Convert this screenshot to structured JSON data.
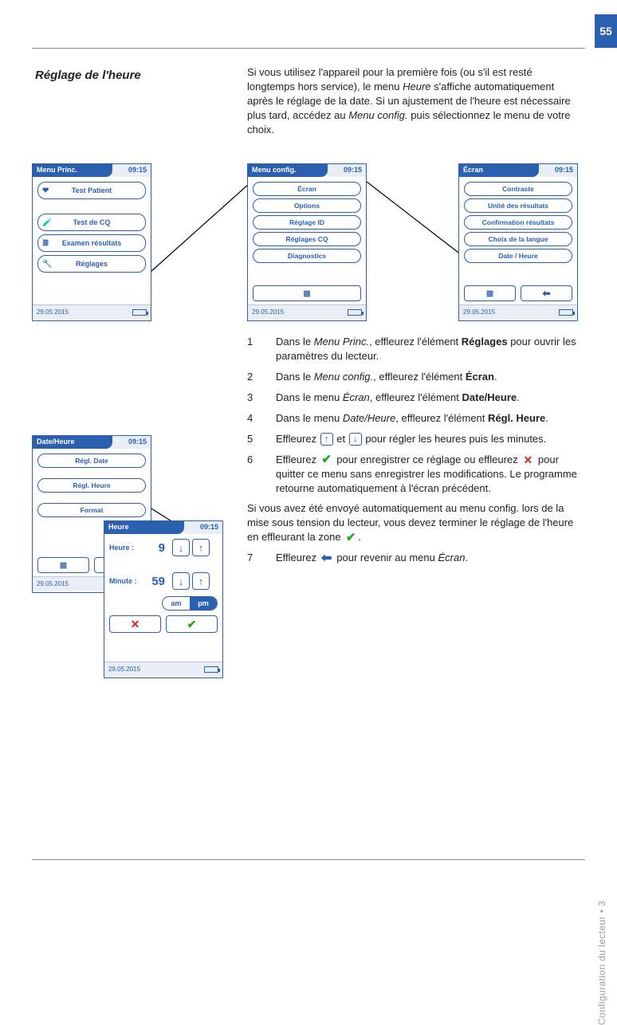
{
  "page_number": "55",
  "heading": "Réglage de l'heure",
  "intro_html": "Si vous utilisez l'appareil pour la première fois (ou s'il est resté longtemps hors service), le menu <span class='ital'>Heure</span> s'affiche automatiquement après le réglage de la date. Si un ajustement de l'heure est nécessaire plus tard, accédez au <span class='ital'>Menu config.</span> puis sélectionnez le menu de votre choix.",
  "side_label": "Configuration du lecteur • 3",
  "device_a": {
    "title": "Menu Princ.",
    "time": "09:15",
    "date": "29.05.2015",
    "items": [
      "Test Patient",
      "Test de CQ",
      "Examen résultats",
      "Réglages"
    ]
  },
  "device_b": {
    "title": "Menu config.",
    "time": "09:15",
    "date": "29.05.2015",
    "items": [
      "Écran",
      "Options",
      "Réglage ID",
      "Réglages CQ",
      "Diagnostics"
    ]
  },
  "device_c": {
    "title": "Écran",
    "time": "09:15",
    "date": "29.05.2015",
    "items": [
      "Contraste",
      "Unité des résultats",
      "Confirmation résultats",
      "Choix de la langue",
      "Date / Heure"
    ]
  },
  "device_d": {
    "title": "Date/Heure",
    "time": "09:15",
    "date": "29.05.2015",
    "items": [
      "Régl. Date",
      "Régl. Heure",
      "Format"
    ]
  },
  "device_e": {
    "title": "Heure",
    "time": "09:15",
    "date": "29.05.2015",
    "hour_label": "Heure :",
    "hour_value": "9",
    "minute_label": "Minute :",
    "minute_value": "59",
    "am": "am",
    "pm": "pm"
  },
  "steps": [
    {
      "n": "1",
      "html": "Dans le <span class='ital'>Menu Princ.</span>, effleurez l'élément <b>Réglages</b> pour ouvrir les paramètres du lecteur."
    },
    {
      "n": "2",
      "html": "Dans le <span class='ital'>Menu config.</span>, effleurez l'élément <b>Écran</b>."
    },
    {
      "n": "3",
      "html": "Dans le menu <span class='ital'>Écran</span>, effleurez l'élément <b>Date/Heure</b>."
    },
    {
      "n": "4",
      "html": "Dans le menu <span class='ital'>Date/Heure</span>, effleurez l'élément <b>Régl. Heure</b>."
    },
    {
      "n": "5",
      "html": "Effleurez <span class='inline-icon'>↑</span> et <span class='inline-icon'>↓</span> pour régler les heures puis les minutes."
    },
    {
      "n": "6",
      "html": "Effleurez <span class='inline-icon green'>✔</span> pour enregistrer ce réglage ou effleurez <span class='inline-icon red'>✕</span> pour quitter ce menu sans enregistrer les modifications. Le programme retourne automatiquement à l'écran précédent."
    }
  ],
  "para_after6": "Si vous avez été envoyé automatiquement au menu config. lors de la mise sous tension du lecteur, vous devez terminer le réglage de l'heure en effleurant la zone <span class='inline-icon green'>✔</span>.",
  "step7": {
    "n": "7",
    "html": "Effleurez <span class='inline-icon arrowback'>⬅</span> pour revenir au menu <span class='ital'>Écran</span>."
  }
}
